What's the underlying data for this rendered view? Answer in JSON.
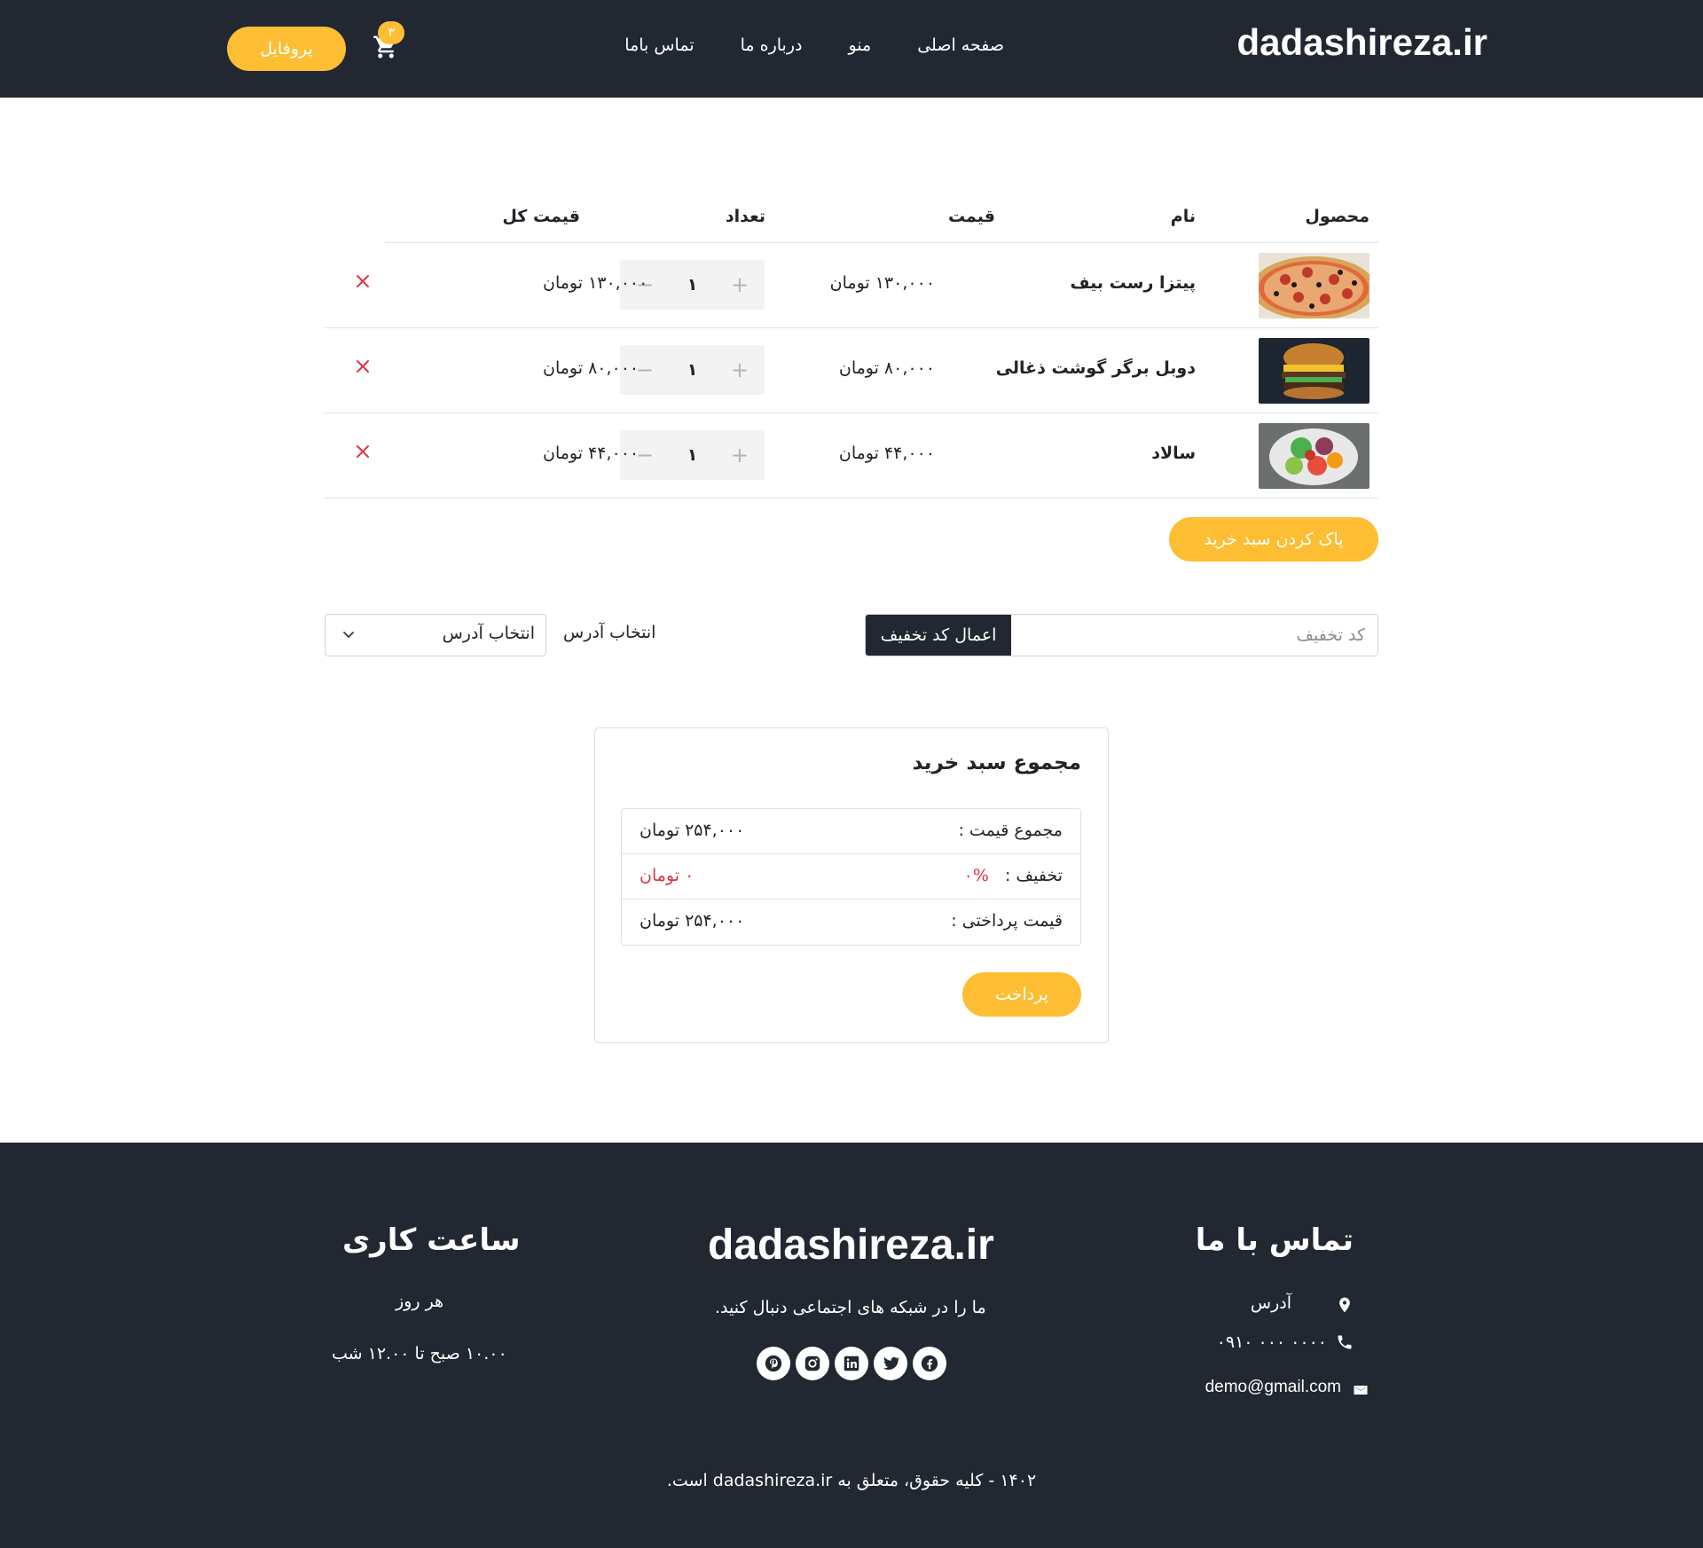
{
  "header": {
    "brand": "dadashireza.ir",
    "nav": [
      "صفحه اصلی",
      "منو",
      "درباره ما",
      "تماس باما"
    ],
    "cart_count": "۳",
    "profile_label": "پروفایل"
  },
  "table": {
    "headers": {
      "product": "محصول",
      "name": "نام",
      "price": "قیمت",
      "qty": "تعداد",
      "total": "قیمت کل"
    },
    "rows": [
      {
        "name": "پیتزا رست بیف",
        "price": "۱۳۰,۰۰۰ تومان",
        "qty": "۱",
        "total": "۱۳۰,۰۰۰ تومان",
        "image": "pizza"
      },
      {
        "name": "دوبل برگر گوشت ذغالی",
        "price": "۸۰,۰۰۰ تومان",
        "qty": "۱",
        "total": "۸۰,۰۰۰ تومان",
        "image": "burger"
      },
      {
        "name": "سالاد",
        "price": "۴۴,۰۰۰ تومان",
        "qty": "۱",
        "total": "۴۴,۰۰۰ تومان",
        "image": "salad"
      }
    ],
    "clear_label": "پاک کردن سبد خرید"
  },
  "coupon": {
    "placeholder": "کد تخفیف",
    "apply_label": "اعمال کد تخفیف"
  },
  "address": {
    "label": "انتخاب آدرس",
    "selected": "انتخاب آدرس"
  },
  "summary": {
    "title": "مجموع سبد خرید",
    "subtotal_label": "مجموع قیمت :",
    "subtotal_value": "۲۵۴,۰۰۰ تومان",
    "discount_label": "تخفیف :",
    "discount_percent": "%۰",
    "discount_value": "۰ تومان",
    "payable_label": "قیمت پرداختی :",
    "payable_value": "۲۵۴,۰۰۰ تومان",
    "pay_label": "پرداخت"
  },
  "footer": {
    "contact_title": "تماس با ما",
    "address": "آدرس",
    "phone": "۰۹۱۰ ۰۰۰ ۰۰۰۰",
    "email": "demo@gmail.com",
    "brand": "dadashireza.ir",
    "social_text": "ما را در شبکه های اجتماعی دنبال کنید.",
    "hours_title": "ساعت کاری",
    "hours_days": "هر روز",
    "hours_time": "۱۰.۰۰ صبح تا ۱۲.۰۰ شب",
    "copyright": "۱۴۰۲ - کلیه حقوق، متعلق به dadashireza.ir است."
  },
  "colors": {
    "dark": "#222831",
    "accent": "#fdbe34",
    "danger": "#dc3545"
  },
  "icons": [
    "cart-icon",
    "remove-icon",
    "chevron-down-icon",
    "location-icon",
    "phone-icon",
    "mail-icon",
    "facebook-icon",
    "twitter-icon",
    "linkedin-icon",
    "instagram-icon",
    "pinterest-icon"
  ]
}
